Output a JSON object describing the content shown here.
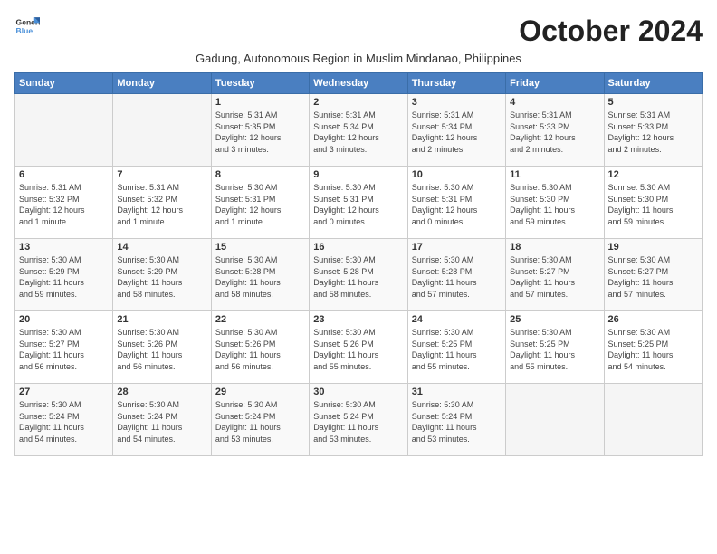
{
  "logo": {
    "line1": "General",
    "line2": "Blue"
  },
  "title": "October 2024",
  "subtitle": "Gadung, Autonomous Region in Muslim Mindanao, Philippines",
  "days_header": [
    "Sunday",
    "Monday",
    "Tuesday",
    "Wednesday",
    "Thursday",
    "Friday",
    "Saturday"
  ],
  "weeks": [
    [
      {
        "day": "",
        "info": ""
      },
      {
        "day": "",
        "info": ""
      },
      {
        "day": "1",
        "info": "Sunrise: 5:31 AM\nSunset: 5:35 PM\nDaylight: 12 hours\nand 3 minutes."
      },
      {
        "day": "2",
        "info": "Sunrise: 5:31 AM\nSunset: 5:34 PM\nDaylight: 12 hours\nand 3 minutes."
      },
      {
        "day": "3",
        "info": "Sunrise: 5:31 AM\nSunset: 5:34 PM\nDaylight: 12 hours\nand 2 minutes."
      },
      {
        "day": "4",
        "info": "Sunrise: 5:31 AM\nSunset: 5:33 PM\nDaylight: 12 hours\nand 2 minutes."
      },
      {
        "day": "5",
        "info": "Sunrise: 5:31 AM\nSunset: 5:33 PM\nDaylight: 12 hours\nand 2 minutes."
      }
    ],
    [
      {
        "day": "6",
        "info": "Sunrise: 5:31 AM\nSunset: 5:32 PM\nDaylight: 12 hours\nand 1 minute."
      },
      {
        "day": "7",
        "info": "Sunrise: 5:31 AM\nSunset: 5:32 PM\nDaylight: 12 hours\nand 1 minute."
      },
      {
        "day": "8",
        "info": "Sunrise: 5:30 AM\nSunset: 5:31 PM\nDaylight: 12 hours\nand 1 minute."
      },
      {
        "day": "9",
        "info": "Sunrise: 5:30 AM\nSunset: 5:31 PM\nDaylight: 12 hours\nand 0 minutes."
      },
      {
        "day": "10",
        "info": "Sunrise: 5:30 AM\nSunset: 5:31 PM\nDaylight: 12 hours\nand 0 minutes."
      },
      {
        "day": "11",
        "info": "Sunrise: 5:30 AM\nSunset: 5:30 PM\nDaylight: 11 hours\nand 59 minutes."
      },
      {
        "day": "12",
        "info": "Sunrise: 5:30 AM\nSunset: 5:30 PM\nDaylight: 11 hours\nand 59 minutes."
      }
    ],
    [
      {
        "day": "13",
        "info": "Sunrise: 5:30 AM\nSunset: 5:29 PM\nDaylight: 11 hours\nand 59 minutes."
      },
      {
        "day": "14",
        "info": "Sunrise: 5:30 AM\nSunset: 5:29 PM\nDaylight: 11 hours\nand 58 minutes."
      },
      {
        "day": "15",
        "info": "Sunrise: 5:30 AM\nSunset: 5:28 PM\nDaylight: 11 hours\nand 58 minutes."
      },
      {
        "day": "16",
        "info": "Sunrise: 5:30 AM\nSunset: 5:28 PM\nDaylight: 11 hours\nand 58 minutes."
      },
      {
        "day": "17",
        "info": "Sunrise: 5:30 AM\nSunset: 5:28 PM\nDaylight: 11 hours\nand 57 minutes."
      },
      {
        "day": "18",
        "info": "Sunrise: 5:30 AM\nSunset: 5:27 PM\nDaylight: 11 hours\nand 57 minutes."
      },
      {
        "day": "19",
        "info": "Sunrise: 5:30 AM\nSunset: 5:27 PM\nDaylight: 11 hours\nand 57 minutes."
      }
    ],
    [
      {
        "day": "20",
        "info": "Sunrise: 5:30 AM\nSunset: 5:27 PM\nDaylight: 11 hours\nand 56 minutes."
      },
      {
        "day": "21",
        "info": "Sunrise: 5:30 AM\nSunset: 5:26 PM\nDaylight: 11 hours\nand 56 minutes."
      },
      {
        "day": "22",
        "info": "Sunrise: 5:30 AM\nSunset: 5:26 PM\nDaylight: 11 hours\nand 56 minutes."
      },
      {
        "day": "23",
        "info": "Sunrise: 5:30 AM\nSunset: 5:26 PM\nDaylight: 11 hours\nand 55 minutes."
      },
      {
        "day": "24",
        "info": "Sunrise: 5:30 AM\nSunset: 5:25 PM\nDaylight: 11 hours\nand 55 minutes."
      },
      {
        "day": "25",
        "info": "Sunrise: 5:30 AM\nSunset: 5:25 PM\nDaylight: 11 hours\nand 55 minutes."
      },
      {
        "day": "26",
        "info": "Sunrise: 5:30 AM\nSunset: 5:25 PM\nDaylight: 11 hours\nand 54 minutes."
      }
    ],
    [
      {
        "day": "27",
        "info": "Sunrise: 5:30 AM\nSunset: 5:24 PM\nDaylight: 11 hours\nand 54 minutes."
      },
      {
        "day": "28",
        "info": "Sunrise: 5:30 AM\nSunset: 5:24 PM\nDaylight: 11 hours\nand 54 minutes."
      },
      {
        "day": "29",
        "info": "Sunrise: 5:30 AM\nSunset: 5:24 PM\nDaylight: 11 hours\nand 53 minutes."
      },
      {
        "day": "30",
        "info": "Sunrise: 5:30 AM\nSunset: 5:24 PM\nDaylight: 11 hours\nand 53 minutes."
      },
      {
        "day": "31",
        "info": "Sunrise: 5:30 AM\nSunset: 5:24 PM\nDaylight: 11 hours\nand 53 minutes."
      },
      {
        "day": "",
        "info": ""
      },
      {
        "day": "",
        "info": ""
      }
    ]
  ]
}
